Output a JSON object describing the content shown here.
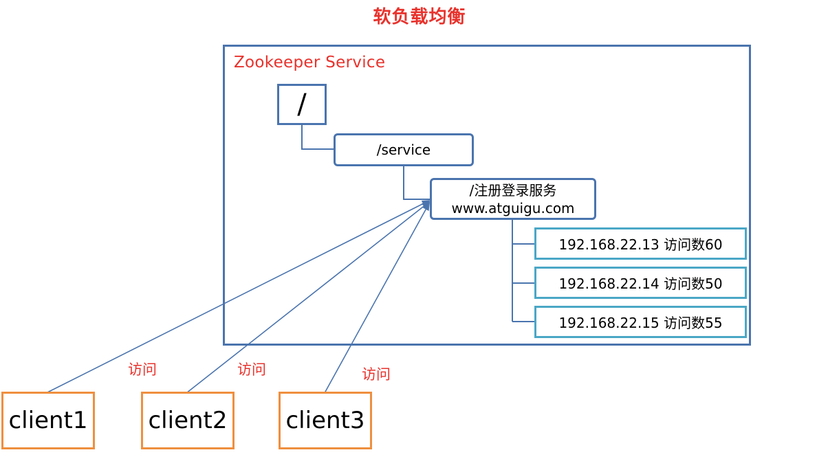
{
  "title": "软负载均衡",
  "zookeeper": {
    "label": "Zookeeper Service",
    "root": "/",
    "service": "/service",
    "registration": {
      "line1": "/注册登录服务",
      "line2": "www.atguigu.com"
    },
    "servers": [
      "192.168.22.13 访问数60",
      "192.168.22.14 访问数50",
      "192.168.22.15 访问数55"
    ]
  },
  "clients": [
    {
      "name": "client1",
      "edge_label": "访问"
    },
    {
      "name": "client2",
      "edge_label": "访问"
    },
    {
      "name": "client3",
      "edge_label": "访问"
    }
  ],
  "colors": {
    "title": "#e8322c",
    "zk_border": "#4a74ae",
    "server_border": "#4aa7c6",
    "client_border": "#ef8f3e",
    "edge": "#4a74ae"
  }
}
